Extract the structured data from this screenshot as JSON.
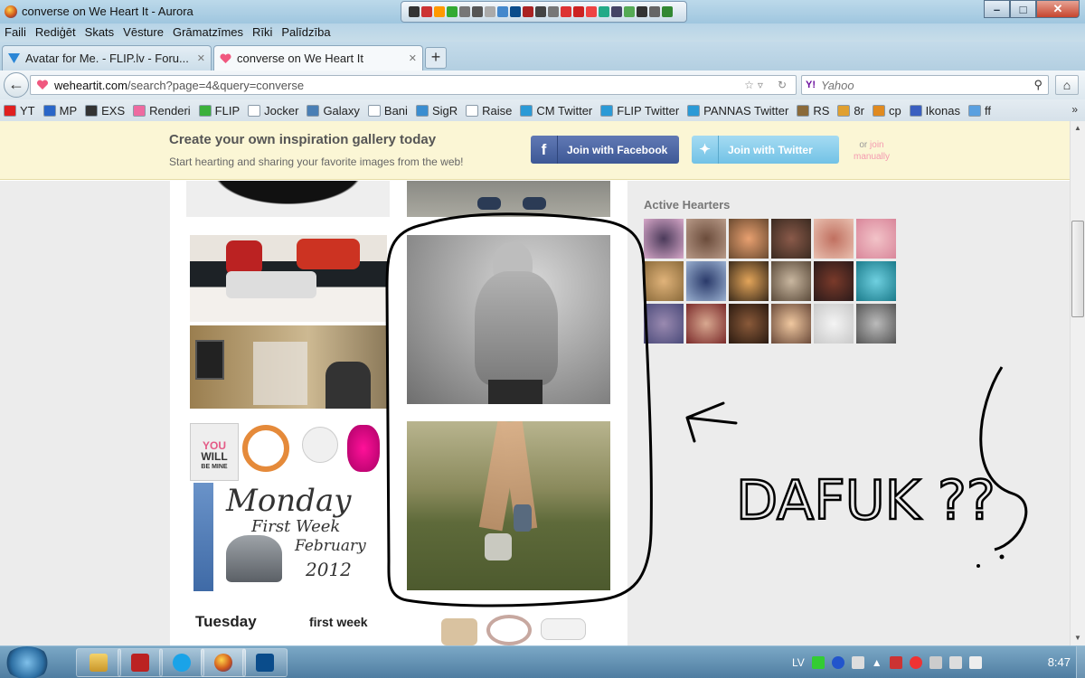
{
  "window": {
    "title": "converse on We Heart It - Aurora"
  },
  "menu": {
    "items": [
      "Faili",
      "Rediģēt",
      "Skats",
      "Vēsture",
      "Grāmatzīmes",
      "Rīki",
      "Palīdzība"
    ]
  },
  "tabs": [
    {
      "label": "Avatar for Me. - FLIP.lv - Foru...",
      "favicon": "flip-icon"
    },
    {
      "label": "converse on We Heart It",
      "favicon": "heart-icon"
    }
  ],
  "nav": {
    "url_domain": "weheartit.com",
    "url_rest": "/search?page=4&query=converse",
    "search_placeholder": "Yahoo",
    "search_engine": "Y!"
  },
  "bookmarks": [
    {
      "label": "YT",
      "color": "#e02020"
    },
    {
      "label": "MP",
      "color": "#2a66c8"
    },
    {
      "label": "EXS",
      "color": "#333333"
    },
    {
      "label": "Renderi",
      "color": "#ee6aa0"
    },
    {
      "label": "FLIP",
      "color": "#3bb03b"
    },
    {
      "label": "Jocker",
      "color": "#ffffff"
    },
    {
      "label": "Galaxy",
      "color": "#4a7fb5"
    },
    {
      "label": "Bani",
      "color": "#ffffff"
    },
    {
      "label": "SigR",
      "color": "#3a8dd0"
    },
    {
      "label": "Raise",
      "color": "#ffffff"
    },
    {
      "label": "CM Twitter",
      "color": "#2b9ad6"
    },
    {
      "label": "FLIP Twitter",
      "color": "#2b9ad6"
    },
    {
      "label": "PANNAS Twitter",
      "color": "#2b9ad6"
    },
    {
      "label": "RS",
      "color": "#8a6a3a"
    },
    {
      "label": "8r",
      "color": "#e0a030"
    },
    {
      "label": "cp",
      "color": "#e08a20"
    },
    {
      "label": "Ikonas",
      "color": "#3a5fc0"
    },
    {
      "label": "ff",
      "color": "#5aa0e0"
    }
  ],
  "banner": {
    "heading": "Create your own inspiration gallery today",
    "subtext": "Start hearting and sharing your favorite images from the web!",
    "facebook_button": "Join with Facebook",
    "twitter_button": "Join with Twitter",
    "or_text": "or",
    "join_manually": "join manually"
  },
  "sidebar": {
    "active_hearters_title": "Active Hearters"
  },
  "collage": {
    "monday": "Monday",
    "first_week": "First Week",
    "february": "February",
    "year": "2012",
    "tshirt_top": "YOU",
    "tshirt_mid": "WILL",
    "tshirt_bot": "BE MINE",
    "tuesday": "Tuesday",
    "first_week_2": "first week"
  },
  "annotation": {
    "text": "DAFUK ??"
  },
  "taskbar": {
    "lang": "LV",
    "time": "8:47"
  }
}
